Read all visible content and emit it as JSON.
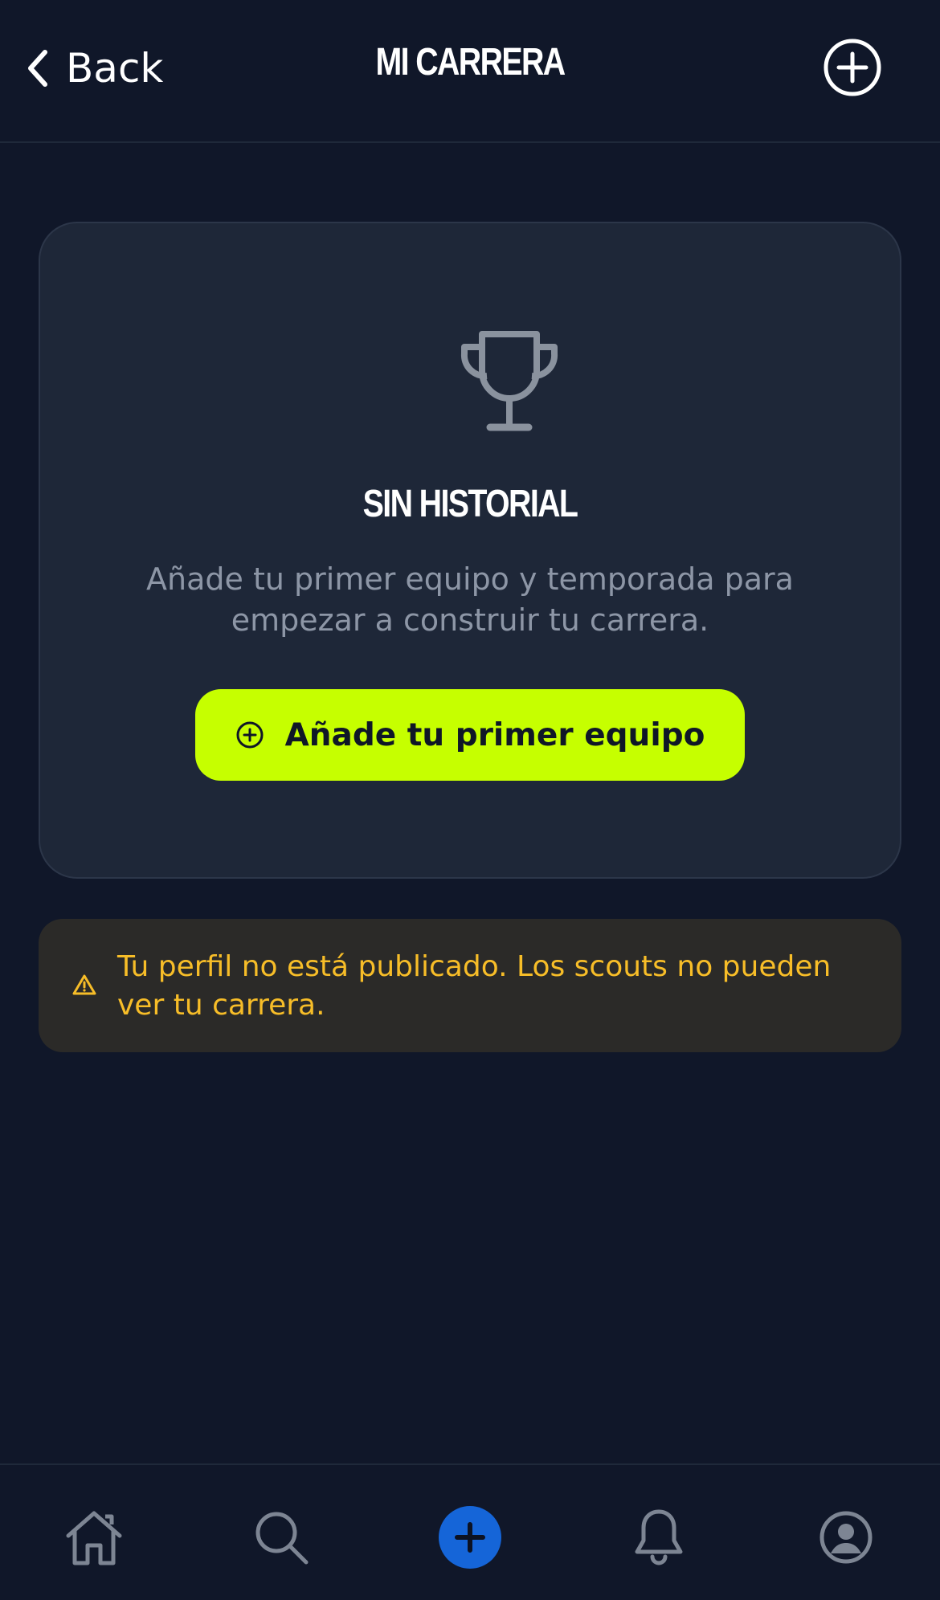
{
  "header": {
    "back_label": "Back",
    "title": "MI CARRERA",
    "add_icon": "plus-circle-icon"
  },
  "empty_state": {
    "icon": "trophy-icon",
    "title": "SIN HISTORIAL",
    "description": "Añade tu primer equipo y temporada para empezar a construir tu carrera.",
    "cta_label": "Añade tu primer equipo",
    "cta_icon": "plus-circle-icon"
  },
  "warning": {
    "icon": "warning-triangle-icon",
    "text": "Tu perfil no está publicado. Los scouts no pueden ver tu carrera."
  },
  "tabbar": {
    "items": [
      {
        "icon": "home-icon"
      },
      {
        "icon": "search-icon"
      },
      {
        "icon": "plus-icon"
      },
      {
        "icon": "bell-icon"
      },
      {
        "icon": "user-circle-icon"
      }
    ]
  },
  "colors": {
    "background": "#101729",
    "card": "#1e2738",
    "accent": "#c6ff00",
    "warning_text": "#f7bd28",
    "warning_bg": "#2b2a28",
    "tab_primary": "#1565d8",
    "muted": "#8d96a6"
  }
}
